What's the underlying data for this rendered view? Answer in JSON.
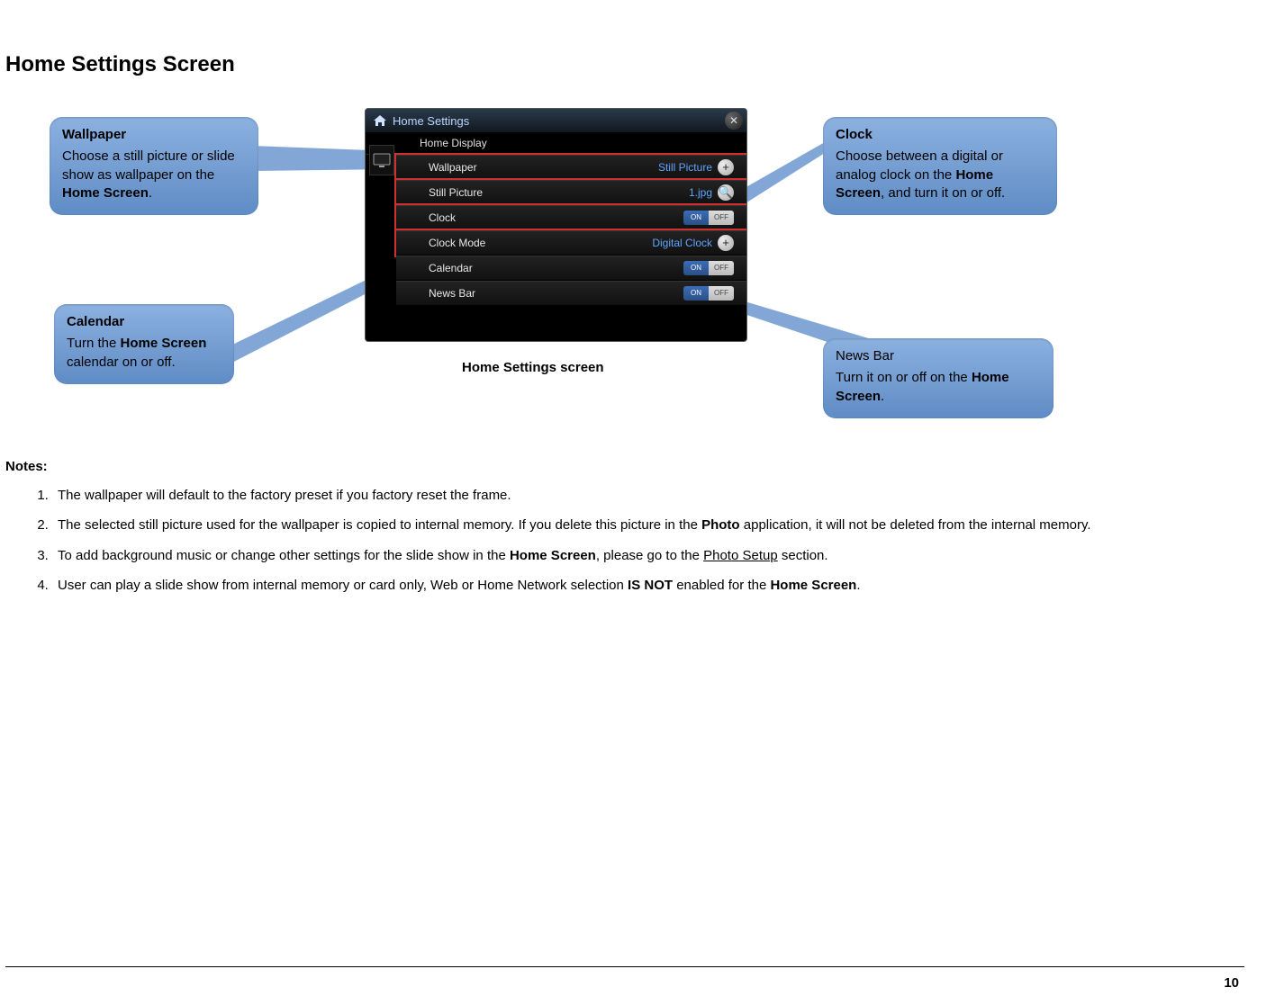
{
  "title": "Home Settings Screen",
  "figure": {
    "caption": "Home Settings screen",
    "screenshot": {
      "window_title": "Home Settings",
      "section_label": "Home Display",
      "rows": {
        "wallpaper": {
          "label": "Wallpaper",
          "value": "Still Picture"
        },
        "still_picture": {
          "label": "Still Picture",
          "value": "1.jpg"
        },
        "clock": {
          "label": "Clock",
          "on": "ON",
          "off": "OFF"
        },
        "clock_mode": {
          "label": "Clock Mode",
          "value": "Digital Clock"
        },
        "calendar": {
          "label": "Calendar",
          "on": "ON",
          "off": "OFF"
        },
        "news_bar": {
          "label": "News Bar",
          "on": "ON",
          "off": "OFF"
        }
      }
    },
    "callouts": {
      "wallpaper": {
        "title": "Wallpaper",
        "body_pre": "Choose a still picture or slide show as wallpaper on the ",
        "body_bold": "Home Screen",
        "body_post": "."
      },
      "calendar": {
        "title": "Calendar",
        "body_pre": " Turn the ",
        "body_bold": "Home Screen",
        "body_post": " calendar on or off."
      },
      "clock": {
        "title": "Clock",
        "body_pre": "Choose between a digital or analog clock on the ",
        "body_bold": "Home Screen",
        "body_post": ", and turn it on or off."
      },
      "newsbar": {
        "title": "News Bar",
        "body_pre": " Turn it on or off on the ",
        "body_bold": "Home Screen",
        "body_post": "."
      }
    }
  },
  "notes": {
    "heading": "Notes:",
    "items": {
      "n1": "The wallpaper will default to the factory preset if you factory reset the frame.",
      "n2_pre": "The selected still picture used for the wallpaper is copied to internal memory.  If you delete this picture in the ",
      "n2_bold": "Photo",
      "n2_post": " application, it will not be deleted from the internal memory.",
      "n3_pre": "To add background music or change other settings for the slide show in the ",
      "n3_bold": "Home Screen",
      "n3_mid": ", please go to the ",
      "n3_link": "Photo Setup",
      "n3_post": " section.",
      "n4_pre": "User can play a slide show from internal memory or card only, Web or Home Network selection ",
      "n4_bold1": "IS NOT",
      "n4_mid": " enabled for the ",
      "n4_bold2": "Home Screen",
      "n4_post": "."
    }
  },
  "page_number": "10"
}
